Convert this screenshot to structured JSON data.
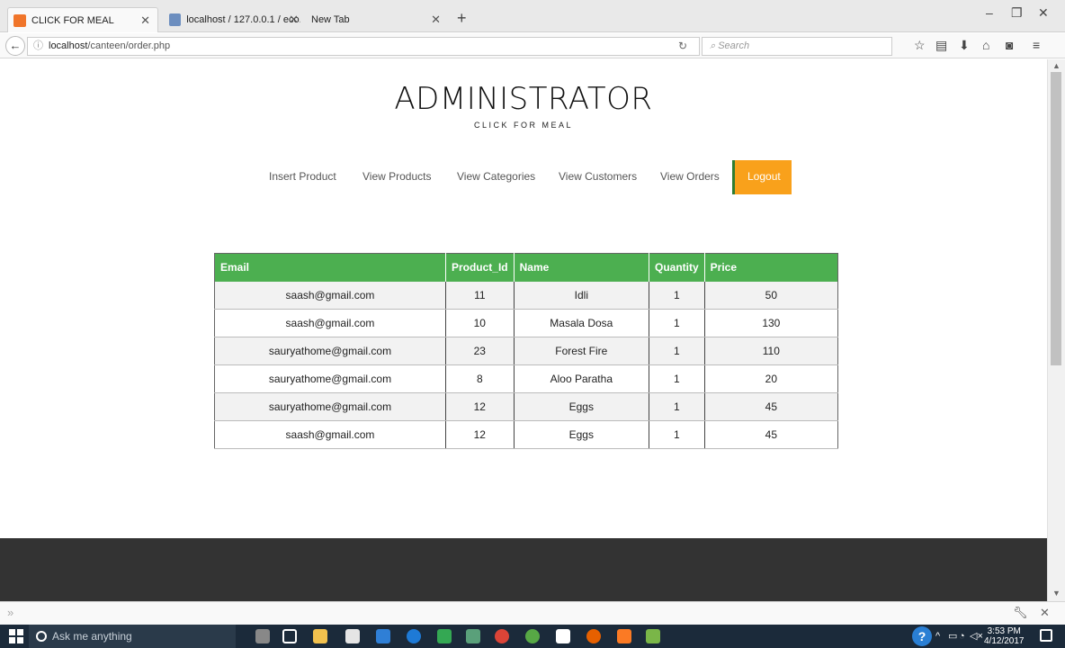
{
  "browser": {
    "tabs": [
      {
        "title": "CLICK FOR MEAL",
        "active": true
      },
      {
        "title": "localhost / 127.0.0.1 / eco...",
        "active": false
      },
      {
        "title": "New Tab",
        "active": false
      }
    ],
    "url_host": "localhost",
    "url_path": "/canteen/order.php",
    "search_placeholder": "Search"
  },
  "page": {
    "title": "ADMINISTRATOR",
    "subtitle": "CLICK FOR MEAL",
    "menu": [
      "Insert Product",
      "View Products",
      "View Categories",
      "View Customers",
      "View Orders",
      "Logout"
    ],
    "table": {
      "headers": [
        "Email",
        "Product_Id",
        "Name",
        "Quantity",
        "Price"
      ],
      "rows": [
        [
          "saash@gmail.com",
          "11",
          "Idli",
          "1",
          "50"
        ],
        [
          "saash@gmail.com",
          "10",
          "Masala Dosa",
          "1",
          "130"
        ],
        [
          "sauryathome@gmail.com",
          "23",
          "Forest Fire",
          "1",
          "110"
        ],
        [
          "sauryathome@gmail.com",
          "8",
          "Aloo Paratha",
          "1",
          "20"
        ],
        [
          "sauryathome@gmail.com",
          "12",
          "Eggs",
          "1",
          "45"
        ],
        [
          "saash@gmail.com",
          "12",
          "Eggs",
          "1",
          "45"
        ]
      ]
    }
  },
  "taskbar": {
    "search_placeholder": "Ask me anything",
    "time": "3:53 PM",
    "date": "4/12/2017"
  },
  "colors": {
    "header_green": "#4caf50",
    "logout_orange": "#f9a11b",
    "footer_dark": "#333333"
  }
}
